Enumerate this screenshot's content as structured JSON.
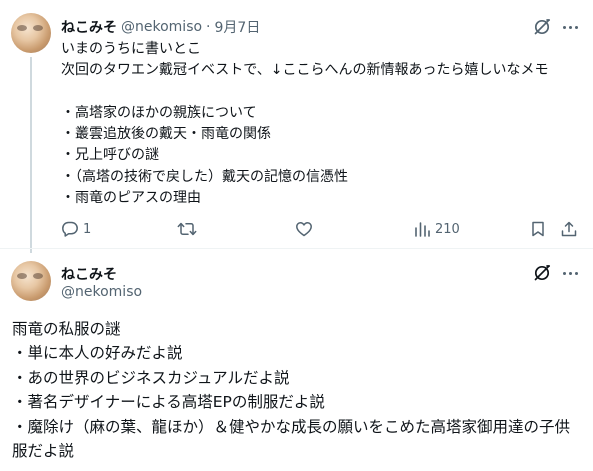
{
  "tweet1": {
    "display_name": "ねこみそ",
    "handle": "@nekomiso",
    "separator": "·",
    "date": "9月7日",
    "lines": [
      "いまのうちに書いとこ",
      "次回のタワエン戴冠イベストで、↓ここらへんの新情報あったら嬉しいなメモ",
      "",
      "・高塔家のほかの親族について",
      "・叢雲追放後の戴天・雨竜の関係",
      "・兄上呼びの謎",
      "・（高塔の技術で戻した）戴天の記憶の信憑性",
      "・雨竜のピアスの理由"
    ],
    "actions": {
      "reply_count": "1",
      "retweet_count": "",
      "like_count": "",
      "views_count": "210"
    }
  },
  "tweet2": {
    "display_name": "ねこみそ",
    "handle": "@nekomiso",
    "lines": [
      "雨竜の私服の謎",
      "・単に本人の好みだよ説",
      "・あの世界のビジネスカジュアルだよ説",
      "・著名デザイナーによる高塔EPの制服だよ説",
      "・魔除け（麻の葉、龍ほか）＆健やかな成長の願いをこめた高塔家御用達の子供",
      "服だよ説"
    ]
  },
  "icons": {
    "grok": "grok-icon",
    "more": "more-icon",
    "reply": "reply-icon",
    "retweet": "retweet-icon",
    "like": "like-icon",
    "views": "views-icon",
    "bookmark": "bookmark-icon",
    "share": "share-icon"
  },
  "colors": {
    "text": "#0f1419",
    "muted": "#536471",
    "thread_line": "#cfd9de",
    "divider": "#eff3f4"
  }
}
